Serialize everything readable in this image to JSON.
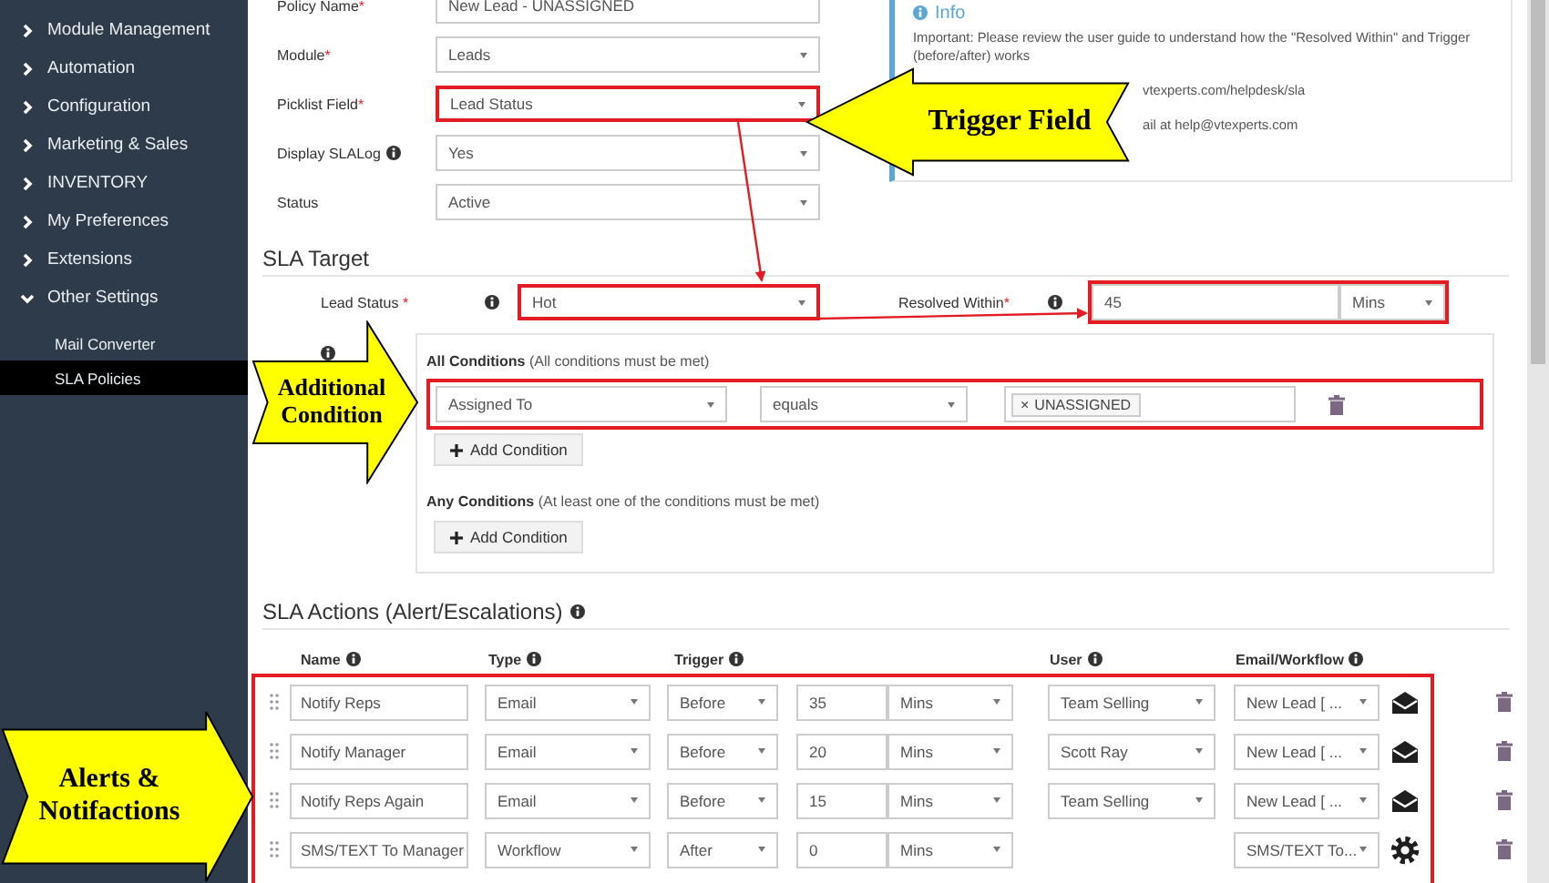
{
  "sidebar": {
    "items": [
      {
        "label": "Module Management",
        "expanded": false
      },
      {
        "label": "Automation",
        "expanded": false
      },
      {
        "label": "Configuration",
        "expanded": false
      },
      {
        "label": "Marketing & Sales",
        "expanded": false
      },
      {
        "label": "INVENTORY",
        "expanded": false
      },
      {
        "label": "My Preferences",
        "expanded": false
      },
      {
        "label": "Extensions",
        "expanded": false
      },
      {
        "label": "Other Settings",
        "expanded": true,
        "children": [
          {
            "label": "Mail Converter",
            "selected": false
          },
          {
            "label": "SLA Policies",
            "selected": true
          }
        ]
      }
    ]
  },
  "policy_form": {
    "fields": [
      {
        "label": "Policy Name",
        "mark": "*",
        "info_icon": false,
        "kind": "text",
        "value": "New Lead - UNASSIGNED",
        "highlighted": false
      },
      {
        "label": "Module",
        "mark": "*",
        "info_icon": false,
        "kind": "select",
        "value": "Leads",
        "highlighted": false
      },
      {
        "label": "Picklist Field",
        "mark": "*",
        "info_icon": false,
        "kind": "select",
        "value": "Lead Status",
        "highlighted": true
      },
      {
        "label": "Display SLALog",
        "info_icon": true,
        "kind": "select",
        "value": "Yes",
        "highlighted": false
      },
      {
        "label": "Status",
        "info_icon": false,
        "kind": "select",
        "value": "Active",
        "highlighted": false
      }
    ]
  },
  "info_box": {
    "title": "Info",
    "lines": [
      "Important: Please review the user guide to understand how the \"Resolved Within\" and Trigger",
      "(before/after) works",
      "vtexperts.com/helpdesk/sla",
      "ail at help@vtexperts.com"
    ]
  },
  "sla_target": {
    "title": "SLA Target",
    "lead_status": {
      "label": "Lead Status",
      "mark": "*",
      "value": "Hot",
      "highlighted": true
    },
    "resolved_within": {
      "label": "Resolved Within",
      "mark": "*",
      "value": "45",
      "unit": "Mins",
      "highlighted": true
    },
    "all_conditions": {
      "title": "All Conditions",
      "note": "(All conditions must be met)",
      "button": "Add Condition",
      "rows": [
        {
          "field": "Assigned To",
          "operator": "equals",
          "values": [
            {
              "remove": "×",
              "text": "UNASSIGNED"
            }
          ],
          "highlighted": true
        }
      ]
    },
    "any_conditions": {
      "title": "Any Conditions",
      "note": "(At least one of the conditions must be met)",
      "button": "Add Condition"
    }
  },
  "sla_actions": {
    "title": "SLA Actions (Alert/Escalations)",
    "highlighted": true,
    "columns": [
      "Name",
      "Type",
      "Trigger",
      "User",
      "Email/Workflow"
    ],
    "rows": [
      {
        "kind": "email",
        "name": "Notify Reps",
        "type": "Email",
        "when": "Before",
        "amount": "35",
        "unit": "Mins",
        "user": "Team Selling",
        "template": "New Lead [ ..."
      },
      {
        "kind": "email",
        "name": "Notify Manager",
        "type": "Email",
        "when": "Before",
        "amount": "20",
        "unit": "Mins",
        "user": "Scott Ray",
        "template": "New Lead [ ..."
      },
      {
        "kind": "email",
        "name": "Notify Reps Again",
        "type": "Email",
        "when": "Before",
        "amount": "15",
        "unit": "Mins",
        "user": "Team Selling",
        "template": "New Lead [ ..."
      },
      {
        "kind": "workflow",
        "name": "SMS/TEXT To Manager",
        "type": "Workflow",
        "when": "After",
        "amount": "0",
        "unit": "Mins",
        "template": "SMS/TEXT To..."
      }
    ]
  },
  "callouts": [
    {
      "kind": "left",
      "text": "Trigger Field"
    },
    {
      "kind": "right",
      "text": "Additional Condition"
    },
    {
      "kind": "right",
      "text": "Alerts & Notifactions"
    }
  ]
}
